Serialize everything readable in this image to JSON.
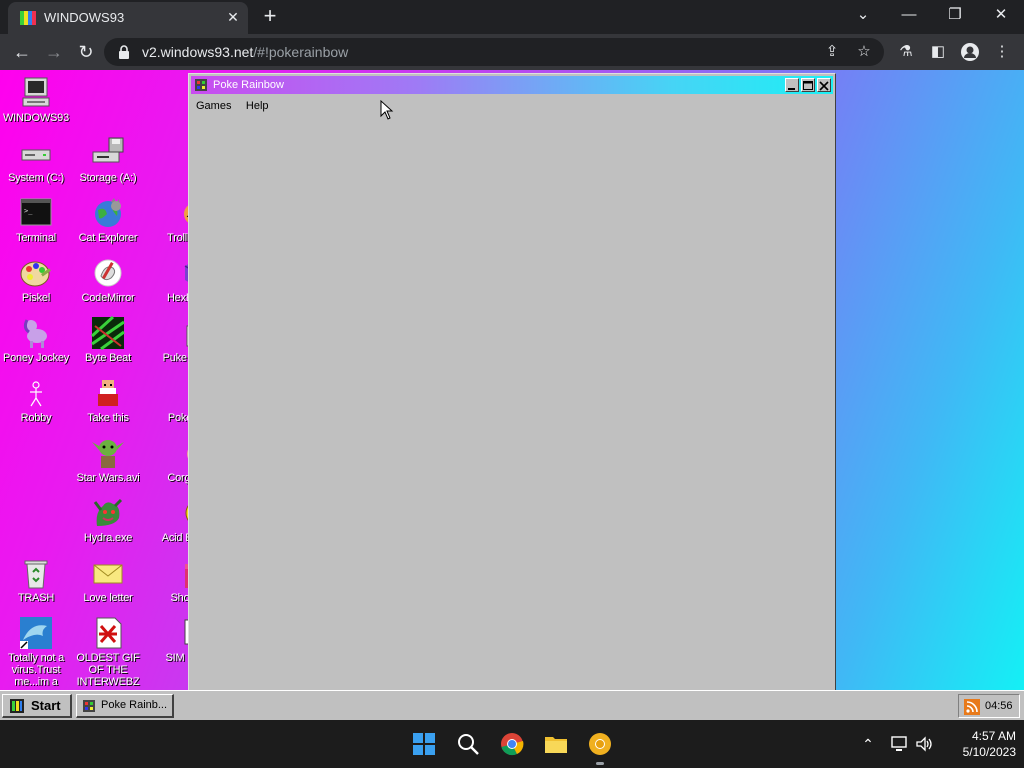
{
  "browser": {
    "tab_title": "WINDOWS93",
    "url_host": "v2.windows93.net",
    "url_rest": "/#!pokerainbow"
  },
  "desktop": {
    "icons": [
      {
        "label": "WINDOWS93",
        "icon": "computer-icon"
      },
      {
        "label": "System (C:)",
        "icon": "drive-icon"
      },
      {
        "label": "Storage (A:)",
        "icon": "floppy-drive-icon"
      },
      {
        "label": "Terminal",
        "icon": "terminal-icon"
      },
      {
        "label": "Cat Explorer",
        "icon": "cat-globe-icon"
      },
      {
        "label": "Trollb",
        "icon": "troll-icon"
      },
      {
        "label": "Piskel",
        "icon": "palette-icon"
      },
      {
        "label": "CodeMirror",
        "icon": "codemirror-icon"
      },
      {
        "label": "HexE",
        "icon": "hex-cube-icon"
      },
      {
        "label": "Poney Jockey",
        "icon": "pony-icon"
      },
      {
        "label": "Byte Beat",
        "icon": "bytebeat-icon"
      },
      {
        "label": "Puke D",
        "icon": "pd-icon"
      },
      {
        "label": "Robby",
        "icon": "stick-figure-icon"
      },
      {
        "label": "Take this",
        "icon": "old-man-icon"
      },
      {
        "label": "Poke",
        "icon": "pokeball-icon"
      },
      {
        "label": "Star Wars.avi",
        "icon": "yoda-icon"
      },
      {
        "label": "Corgi",
        "icon": "corgi-icon"
      },
      {
        "label": "Hydra.exe",
        "icon": "hydra-icon"
      },
      {
        "label": "Acid Bo",
        "icon": "smiley-icon"
      },
      {
        "label": "TRASH",
        "icon": "trash-icon"
      },
      {
        "label": "Love letter",
        "icon": "envelope-icon"
      },
      {
        "label": "Sho",
        "icon": "gift-icon"
      },
      {
        "label": "Totally not a virus.Trust me...im a",
        "icon": "dolphin-icon"
      },
      {
        "label": "OLDEST GIF OF THE INTERWEBZ",
        "icon": "gif-icon"
      },
      {
        "label": "SIM S",
        "icon": "sim-icon"
      }
    ]
  },
  "app_window": {
    "title": "Poke Rainbow",
    "menu": [
      "Games",
      "Help"
    ]
  },
  "w93_taskbar": {
    "start_label": "Start",
    "task_label": "Poke Rainb...",
    "tray_time": "04:56"
  },
  "os_taskbar": {
    "time": "4:57 AM",
    "date": "5/10/2023"
  },
  "colors": {
    "desktop_gradient_start": "#ff00ee",
    "desktop_gradient_end": "#14f0f5",
    "window_face": "#c0c0c0"
  }
}
